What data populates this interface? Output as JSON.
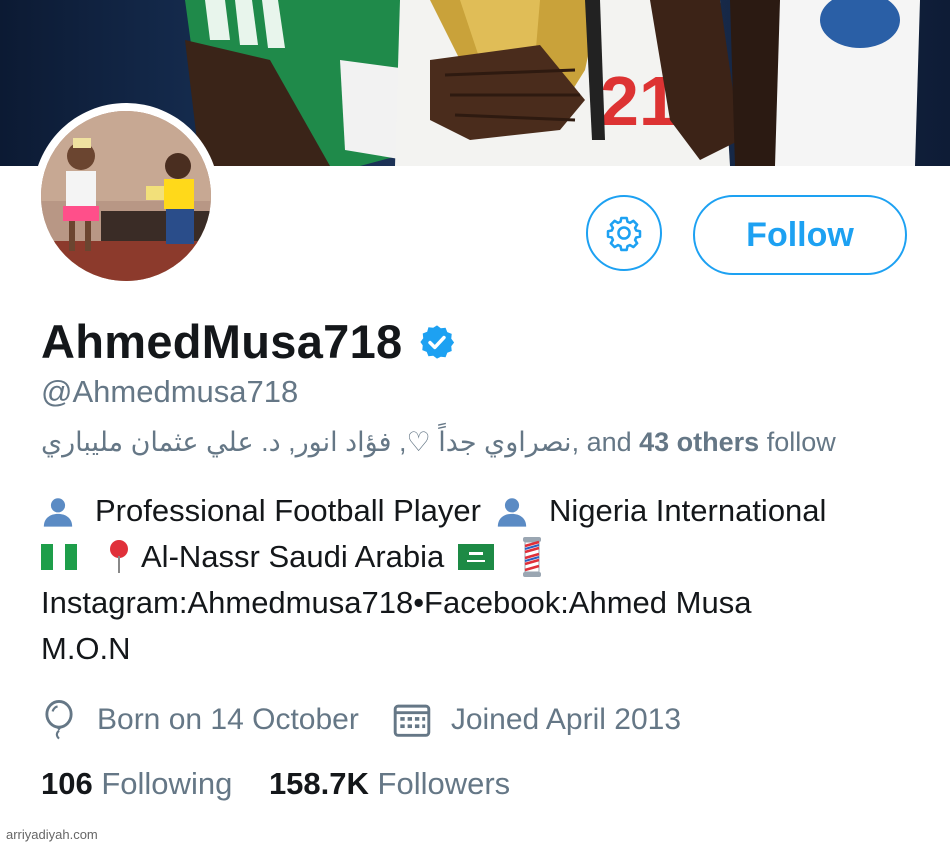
{
  "profile": {
    "display_name": "AhmedMusa718",
    "handle": "@Ahmedmusa718",
    "verified": true
  },
  "actions": {
    "settings_icon": "gear-icon",
    "follow_label": "Follow"
  },
  "followed_by": {
    "names": "نصراوي جداً ♡, فؤاد انور, د. علي عثمان مليباري",
    "separator": ", and",
    "count": "43 others",
    "suffix": "follow"
  },
  "bio": {
    "line1_a": "Professional Football Player",
    "line1_b": "Nigeria International",
    "line2": "Al-Nassr Saudi Arabia",
    "line3": "Instagram:Ahmedmusa718•Facebook:Ahmed Musa",
    "line4": "M.O.N"
  },
  "meta": {
    "birthday": "Born on 14 October",
    "joined": "Joined April 2013"
  },
  "stats": {
    "following_count": "106",
    "following_label": "Following",
    "followers_count": "158.7K",
    "followers_label": "Followers"
  },
  "watermark": "arriyadiyah.com",
  "colors": {
    "accent": "#1da1f2",
    "secondary_text": "#657786",
    "primary_text": "#14171a"
  },
  "icons": [
    "gear-icon",
    "verified-badge-icon",
    "person-icon",
    "nigeria-flag-icon",
    "pin-icon",
    "saudi-flag-icon",
    "barber-pole-icon",
    "balloon-icon",
    "calendar-icon"
  ]
}
